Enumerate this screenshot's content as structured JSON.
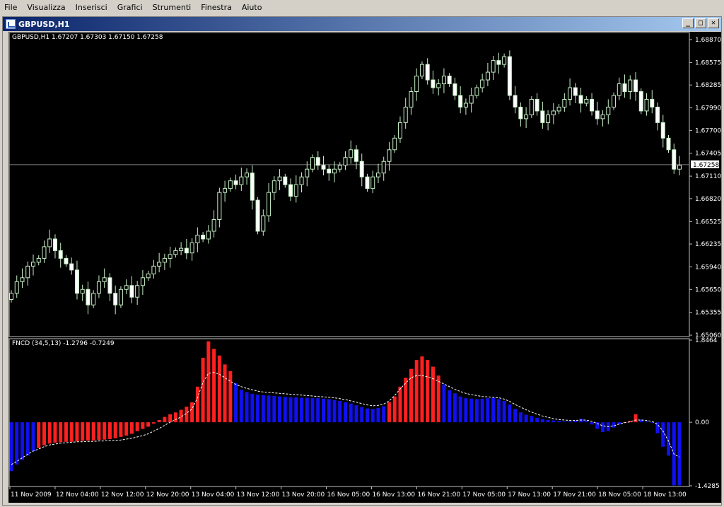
{
  "menu": [
    "File",
    "Visualizza",
    "Inserisci",
    "Grafici",
    "Strumenti",
    "Finestra",
    "Aiuto"
  ],
  "window": {
    "title": "GBPUSD,H1",
    "buttons": [
      "_",
      "□",
      "✕"
    ]
  },
  "colors": {
    "background": "#000000",
    "bull": "#000000",
    "candle_stroke": "#c8f0c8",
    "bear": "#ffffff",
    "hist_positive": "#ff2020",
    "hist_negative": "#1010f0",
    "signal": "#ffffff",
    "axis_text": "#ffffff",
    "bid_line": "#808080"
  },
  "chart_data": [
    {
      "type": "candlestick",
      "title": "GBPUSD,H1  1.67207 1.67303 1.67150 1.67258",
      "y_ticks": [
        "1.68870",
        "1.68575",
        "1.68285",
        "1.67990",
        "1.67700",
        "1.67405",
        "1.67110",
        "1.66820",
        "1.66525",
        "1.66235",
        "1.65940",
        "1.65650",
        "1.65355",
        "1.65060"
      ],
      "ylim": [
        1.6506,
        1.6887
      ],
      "current_price": "1.67258",
      "current_value": 1.67258,
      "x_labels": [
        "11 Nov 2009",
        "12 Nov 04:00",
        "12 Nov 12:00",
        "12 Nov 20:00",
        "13 Nov 04:00",
        "13 Nov 12:00",
        "13 Nov 20:00",
        "16 Nov 05:00",
        "16 Nov 13:00",
        "16 Nov 21:00",
        "17 Nov 05:00",
        "17 Nov 13:00",
        "17 Nov 21:00",
        "18 Nov 05:00",
        "18 Nov 13:00"
      ],
      "close": [
        1.656,
        1.6575,
        1.658,
        1.6595,
        1.66,
        1.6605,
        1.662,
        1.663,
        1.6615,
        1.6605,
        1.6598,
        1.659,
        1.656,
        1.6565,
        1.6545,
        1.656,
        1.6575,
        1.658,
        1.656,
        1.6545,
        1.6565,
        1.657,
        1.6555,
        1.657,
        1.658,
        1.6585,
        1.6595,
        1.66,
        1.6605,
        1.661,
        1.6615,
        1.6618,
        1.6612,
        1.6625,
        1.6635,
        1.663,
        1.664,
        1.6655,
        1.669,
        1.6695,
        1.6705,
        1.67,
        1.671,
        1.6715,
        1.668,
        1.664,
        1.666,
        1.669,
        1.6705,
        1.671,
        1.67,
        1.6685,
        1.67,
        1.671,
        1.672,
        1.6735,
        1.6725,
        1.672,
        1.6715,
        1.672,
        1.6725,
        1.6735,
        1.6745,
        1.673,
        1.671,
        1.6695,
        1.671,
        1.6715,
        1.673,
        1.6745,
        1.676,
        1.678,
        1.68,
        1.682,
        1.684,
        1.6855,
        1.6835,
        1.6825,
        1.683,
        1.684,
        1.683,
        1.6815,
        1.68,
        1.6805,
        1.6815,
        1.6825,
        1.6835,
        1.6845,
        1.686,
        1.6855,
        1.6865,
        1.6815,
        1.68,
        1.6785,
        1.679,
        1.681,
        1.6795,
        1.678,
        1.679,
        1.6795,
        1.68,
        1.681,
        1.6825,
        1.6815,
        1.6805,
        1.681,
        1.6795,
        1.6785,
        1.679,
        1.68,
        1.6815,
        1.683,
        1.682,
        1.6835,
        1.682,
        1.6795,
        1.681,
        1.68,
        1.678,
        1.676,
        1.6745,
        1.672,
        1.6725
      ]
    },
    {
      "type": "bar",
      "title": "FNCD (34,5,13) -1.2796 -0.7249",
      "y_ticks": [
        "1.8464",
        "0.00",
        "-1.4285"
      ],
      "ylim": [
        -1.4285,
        1.8464
      ],
      "histogram": [
        -1.1,
        -0.95,
        -0.85,
        -0.75,
        -0.65,
        -0.58,
        -0.52,
        -0.48,
        -0.46,
        -0.45,
        -0.44,
        -0.44,
        -0.43,
        -0.42,
        -0.41,
        -0.41,
        -0.4,
        -0.39,
        -0.38,
        -0.36,
        -0.33,
        -0.3,
        -0.26,
        -0.2,
        -0.15,
        -0.1,
        -0.03,
        0.05,
        0.12,
        0.18,
        0.22,
        0.28,
        0.35,
        0.45,
        0.8,
        1.45,
        1.82,
        1.65,
        1.5,
        1.3,
        1.15,
        0.88,
        0.73,
        0.68,
        0.64,
        0.62,
        0.61,
        0.6,
        0.59,
        0.58,
        0.57,
        0.56,
        0.56,
        0.55,
        0.55,
        0.54,
        0.54,
        0.53,
        0.52,
        0.5,
        0.48,
        0.45,
        0.42,
        0.38,
        0.34,
        0.31,
        0.3,
        0.32,
        0.36,
        0.45,
        0.58,
        0.8,
        1.0,
        1.2,
        1.4,
        1.48,
        1.4,
        1.25,
        1.05,
        0.85,
        0.72,
        0.65,
        0.58,
        0.54,
        0.53,
        0.52,
        0.53,
        0.54,
        0.55,
        0.52,
        0.48,
        0.4,
        0.3,
        0.22,
        0.17,
        0.14,
        0.1,
        0.07,
        0.05,
        0.04,
        0.03,
        0.02,
        0.02,
        0.04,
        0.08,
        0.04,
        -0.05,
        -0.15,
        -0.22,
        -0.2,
        -0.12,
        -0.05,
        0.0,
        0.03,
        0.18,
        0.06,
        0.02,
        0.0,
        -0.25,
        -0.55,
        -0.75,
        -1.42,
        -1.42
      ],
      "histogram_positive_flags": [
        0,
        0,
        0,
        0,
        0,
        1,
        1,
        1,
        1,
        1,
        1,
        1,
        1,
        1,
        1,
        1,
        1,
        1,
        1,
        1,
        1,
        1,
        1,
        1,
        1,
        1,
        1,
        1,
        1,
        1,
        1,
        1,
        1,
        1,
        1,
        1,
        1,
        1,
        1,
        1,
        1,
        0,
        0,
        0,
        0,
        0,
        0,
        0,
        0,
        0,
        0,
        0,
        0,
        0,
        0,
        0,
        0,
        0,
        0,
        0,
        0,
        0,
        0,
        0,
        0,
        0,
        0,
        0,
        0,
        1,
        1,
        1,
        1,
        1,
        1,
        1,
        1,
        1,
        1,
        0,
        0,
        0,
        0,
        0,
        0,
        0,
        0,
        0,
        0,
        0,
        0,
        0,
        0,
        0,
        0,
        0,
        0,
        0,
        0,
        0,
        0,
        0,
        0,
        0,
        0,
        0,
        0,
        0,
        0,
        0,
        0,
        0,
        1,
        1,
        1,
        0,
        0,
        0,
        0,
        0,
        0,
        0
      ],
      "signal": [
        -0.95,
        -0.88,
        -0.8,
        -0.72,
        -0.65,
        -0.6,
        -0.55,
        -0.51,
        -0.49,
        -0.47,
        -0.46,
        -0.45,
        -0.44,
        -0.44,
        -0.43,
        -0.43,
        -0.42,
        -0.42,
        -0.41,
        -0.41,
        -0.4,
        -0.38,
        -0.36,
        -0.33,
        -0.3,
        -0.26,
        -0.2,
        -0.14,
        -0.07,
        0.0,
        0.06,
        0.12,
        0.2,
        0.3,
        0.55,
        0.9,
        1.1,
        1.12,
        1.08,
        1.0,
        0.92,
        0.85,
        0.8,
        0.76,
        0.73,
        0.7,
        0.68,
        0.67,
        0.66,
        0.65,
        0.64,
        0.63,
        0.62,
        0.61,
        0.6,
        0.59,
        0.58,
        0.57,
        0.56,
        0.55,
        0.53,
        0.51,
        0.48,
        0.45,
        0.42,
        0.39,
        0.37,
        0.38,
        0.41,
        0.48,
        0.6,
        0.75,
        0.88,
        1.0,
        1.05,
        1.05,
        1.02,
        0.98,
        0.92,
        0.86,
        0.8,
        0.74,
        0.69,
        0.65,
        0.62,
        0.6,
        0.58,
        0.57,
        0.56,
        0.55,
        0.52,
        0.47,
        0.4,
        0.34,
        0.28,
        0.23,
        0.18,
        0.14,
        0.11,
        0.08,
        0.06,
        0.05,
        0.04,
        0.04,
        0.05,
        0.05,
        0.02,
        -0.03,
        -0.08,
        -0.1,
        -0.08,
        -0.04,
        -0.01,
        0.01,
        0.05,
        0.05,
        0.04,
        0.02,
        -0.05,
        -0.2,
        -0.42,
        -0.72,
        -0.78
      ]
    }
  ]
}
